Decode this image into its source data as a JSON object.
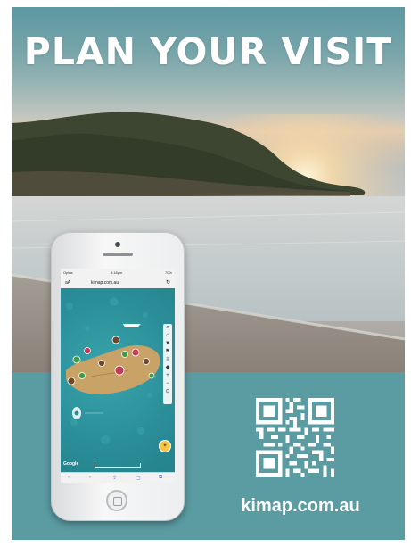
{
  "headline": "PLAN YOUR VISIT",
  "website": "kimap.com.au",
  "phone": {
    "status_carrier": "Optus",
    "status_time": "4:18pm",
    "status_battery": "70%",
    "text_size_label": "aA",
    "domain": "kimap.com.au",
    "reload_symbol": "↻",
    "map_brand": "Google",
    "compass_symbol": "✦",
    "toolbar": [
      "‹",
      "›",
      "⇪",
      "▢",
      "⧉"
    ],
    "sidebar": [
      "⌕",
      "⌂",
      "▼",
      "⚑",
      "≡",
      "◆",
      "+",
      "−",
      "⊙"
    ]
  },
  "colors": {
    "teal": "#5b9ba2",
    "map_water": "#2c8f98",
    "island": "#c9a267",
    "pin_red": "#c23a56",
    "pin_green": "#3f9b47",
    "pin_brown": "#6b4a2a"
  },
  "icons": {
    "qr": "qr-code-icon",
    "home_button": "home-button-icon",
    "location_marker": "location-marker-icon"
  }
}
